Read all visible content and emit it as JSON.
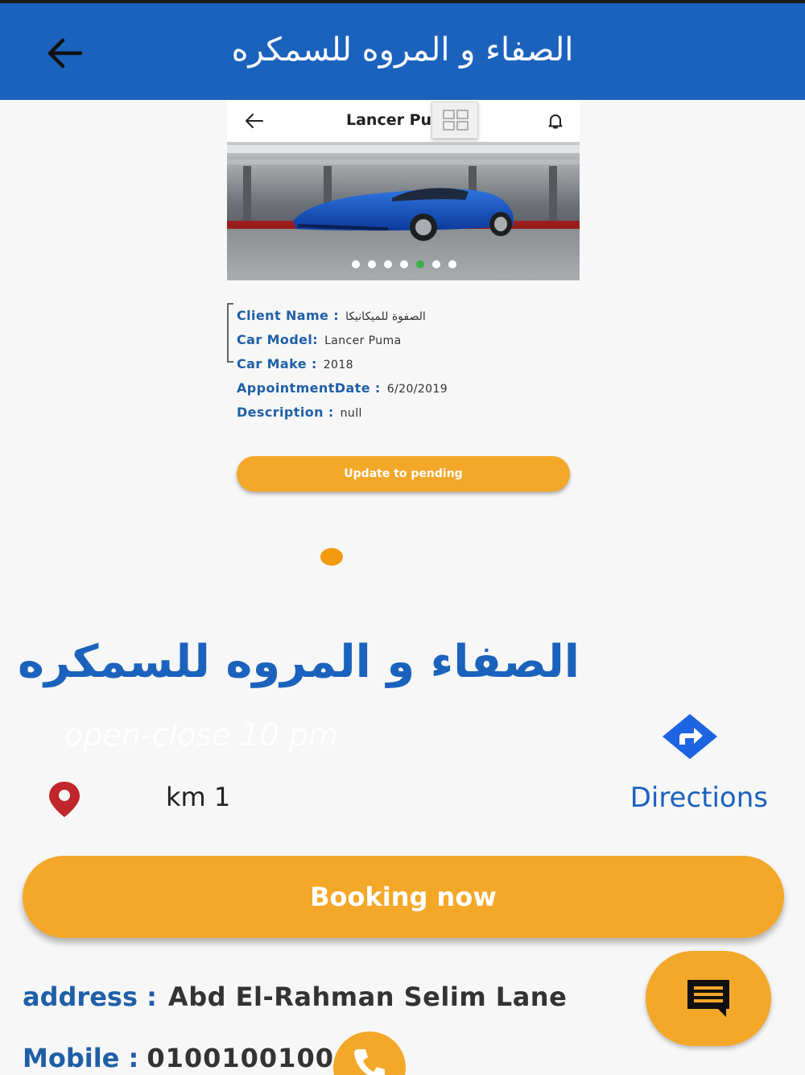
{
  "app_bar": {
    "title": "الصفاء و المروه للسمكره",
    "back_icon": "arrow-left-icon"
  },
  "embedded_screen": {
    "title": "Lancer Pu",
    "back_icon": "arrow-left-icon",
    "bell_icon": "bell-icon",
    "grid_icon": "grid-icon",
    "carousel_dots": 7,
    "carousel_active_index": 4
  },
  "details": {
    "client_name_label": "Client Name :",
    "client_name_value": "الصفوة للميكانيكا",
    "car_model_label": "Car Model:",
    "car_model_value": "Lancer Puma",
    "car_make_label": "Car Make :",
    "car_make_value": "2018",
    "appointment_label": "AppointmentDate :",
    "appointment_value": "6/20/2019",
    "description_label": "Description :",
    "description_value": "null"
  },
  "pending_button": {
    "label": "Update to pending"
  },
  "shop": {
    "name": "الصفاء و المروه للسمكره",
    "hours": "open-close 10 pm",
    "distance": "km 1",
    "directions_label": "Directions"
  },
  "booking_button": {
    "label": "Booking now"
  },
  "contact": {
    "address_label": "address :",
    "address_value": "Abd El-Rahman Selim Lane",
    "mobile_label": "Mobile :",
    "mobile_value": "0100100100"
  },
  "colors": {
    "primary_blue": "#1b62bd",
    "accent_orange": "#f4a829",
    "label_blue": "#1f5fa8"
  }
}
